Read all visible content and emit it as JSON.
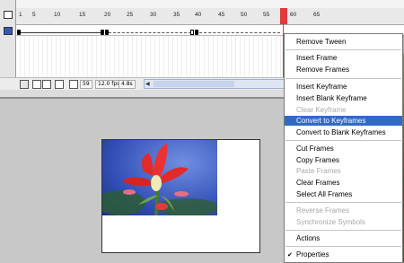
{
  "timeline": {
    "ruler_labels": [
      "1",
      "5",
      "10",
      "15",
      "20",
      "25",
      "30",
      "35",
      "40",
      "45",
      "50",
      "55",
      "60",
      "65"
    ],
    "status": {
      "frame": "59",
      "fps": "12.0 fps",
      "time": "4.8s"
    }
  },
  "context_menu": {
    "items": [
      {
        "label": "Remove Tween",
        "enabled": true,
        "highlighted": false
      },
      {
        "label": "Insert Frame",
        "enabled": true,
        "highlighted": false
      },
      {
        "label": "Remove Frames",
        "enabled": true,
        "highlighted": false
      },
      {
        "label": "Insert Keyframe",
        "enabled": true,
        "highlighted": false
      },
      {
        "label": "Insert Blank Keyframe",
        "enabled": true,
        "highlighted": false
      },
      {
        "label": "Clear Keyframe",
        "enabled": false,
        "highlighted": false
      },
      {
        "label": "Convert to Keyframes",
        "enabled": true,
        "highlighted": true
      },
      {
        "label": "Convert to Blank Keyframes",
        "enabled": true,
        "highlighted": false
      },
      {
        "label": "Cut Frames",
        "enabled": true,
        "highlighted": false
      },
      {
        "label": "Copy Frames",
        "enabled": true,
        "highlighted": false
      },
      {
        "label": "Paste Frames",
        "enabled": false,
        "highlighted": false
      },
      {
        "label": "Clear Frames",
        "enabled": true,
        "highlighted": false
      },
      {
        "label": "Select All Frames",
        "enabled": true,
        "highlighted": false
      },
      {
        "label": "Reverse Frames",
        "enabled": false,
        "highlighted": false
      },
      {
        "label": "Synchronize Symbols",
        "enabled": false,
        "highlighted": false
      },
      {
        "label": "Actions",
        "enabled": true,
        "highlighted": false
      },
      {
        "label": "Properties",
        "enabled": true,
        "highlighted": false,
        "checked": true
      }
    ],
    "check_mark": "✔"
  },
  "icons": {
    "trash": "trash-icon",
    "add_motion_guide": "motion-guide-icon",
    "onion_skin": "onion-skin-icon",
    "edit_markers": "edit-markers-icon"
  },
  "colors": {
    "highlight": "#316ac5",
    "playhead": "#e03a3a",
    "disabled_text": "#a8a8a8"
  }
}
